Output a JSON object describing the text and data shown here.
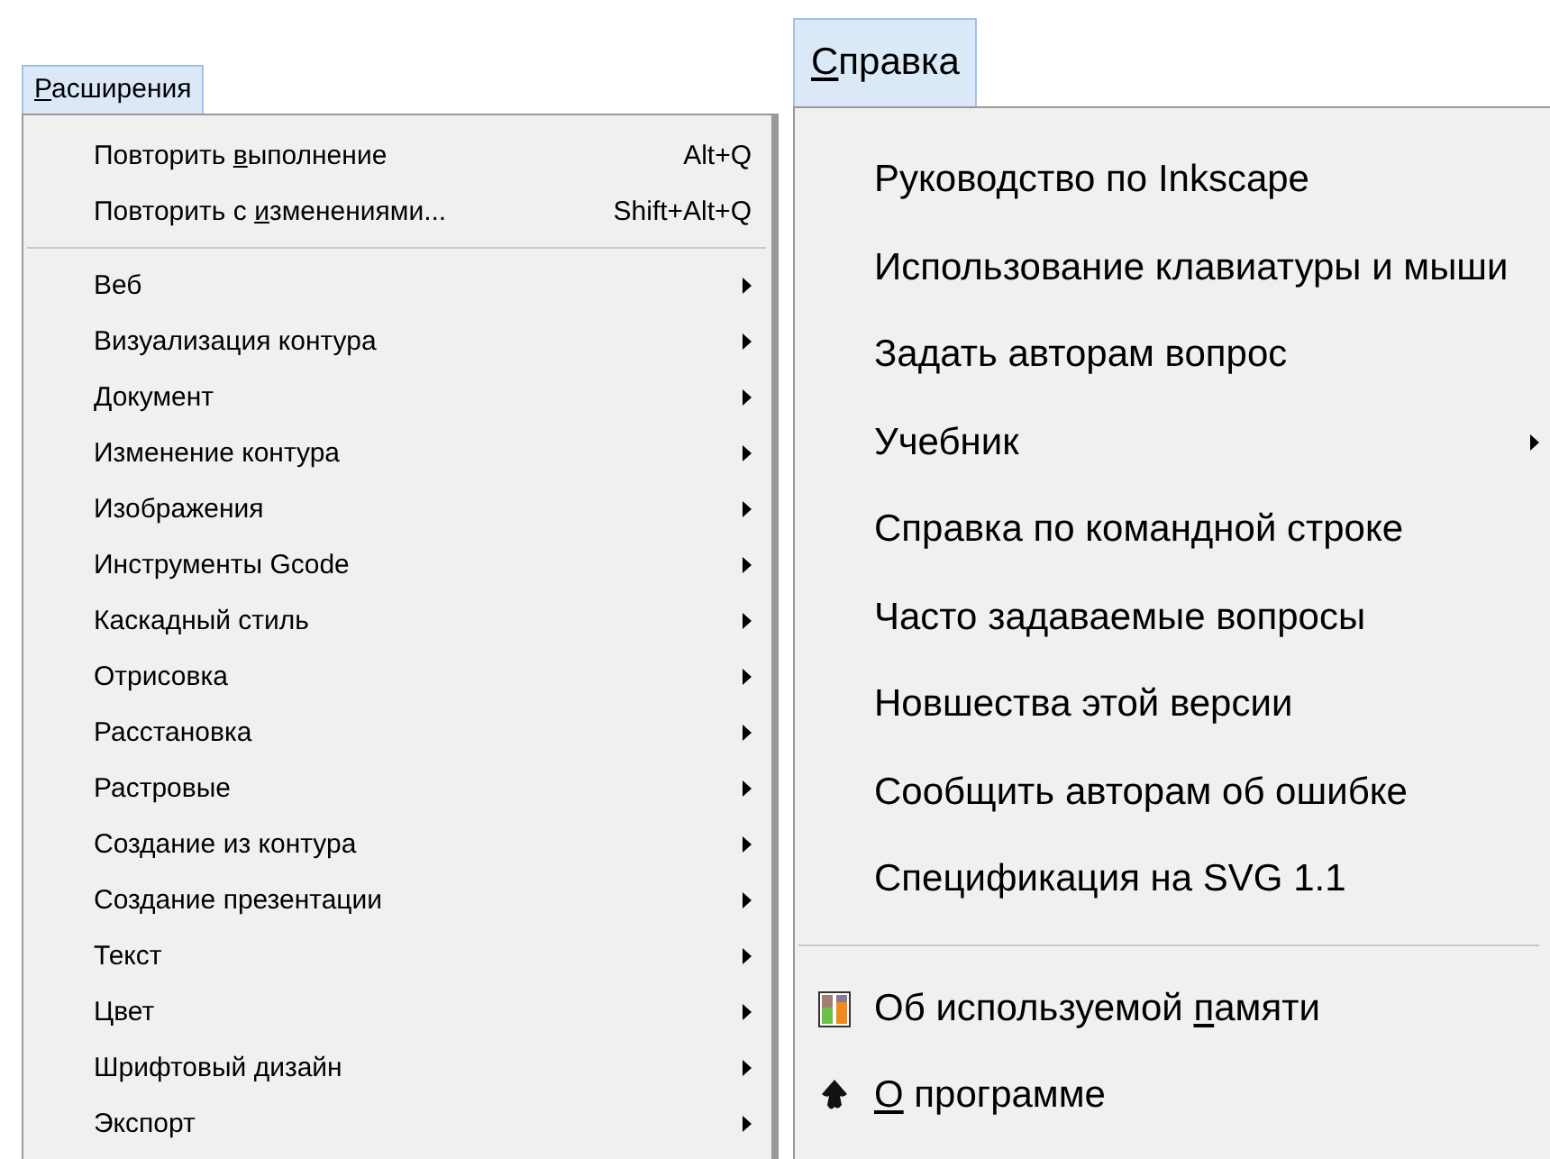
{
  "menus": [
    {
      "title": {
        "key": "Р",
        "after": "асширения"
      },
      "items": [
        {
          "kind": "command",
          "label_before": "Повторить ",
          "access_key": "в",
          "label_after": "ыполнение",
          "shortcut": "Alt+Q"
        },
        {
          "kind": "command",
          "label_before": "Повторить с ",
          "access_key": "и",
          "label_after": "зменениями...",
          "shortcut": "Shift+Alt+Q"
        },
        {
          "kind": "separator"
        },
        {
          "kind": "submenu",
          "label": "Веб"
        },
        {
          "kind": "submenu",
          "label": "Визуализация контура"
        },
        {
          "kind": "submenu",
          "label": "Документ"
        },
        {
          "kind": "submenu",
          "label": "Изменение контура"
        },
        {
          "kind": "submenu",
          "label": "Изображения"
        },
        {
          "kind": "submenu",
          "label": "Инструменты Gcode"
        },
        {
          "kind": "submenu",
          "label": "Каскадный стиль"
        },
        {
          "kind": "submenu",
          "label": "Отрисовка"
        },
        {
          "kind": "submenu",
          "label": "Расстановка"
        },
        {
          "kind": "submenu",
          "label": "Растровые"
        },
        {
          "kind": "submenu",
          "label": "Создание из контура"
        },
        {
          "kind": "submenu",
          "label": "Создание презентации"
        },
        {
          "kind": "submenu",
          "label": "Текст"
        },
        {
          "kind": "submenu",
          "label": "Цвет"
        },
        {
          "kind": "submenu",
          "label": "Шрифтовый дизайн"
        },
        {
          "kind": "submenu",
          "label": "Экспорт"
        }
      ]
    },
    {
      "title": {
        "key": "С",
        "after": "правка"
      },
      "items": [
        {
          "kind": "command",
          "label": "Руководство по Inkscape"
        },
        {
          "kind": "command",
          "label": "Использование клавиатуры и мыши"
        },
        {
          "kind": "command",
          "label": "Задать авторам вопрос"
        },
        {
          "kind": "submenu",
          "label": "Учебник"
        },
        {
          "kind": "command",
          "label": "Справка по командной строке"
        },
        {
          "kind": "command",
          "label": "Часто задаваемые вопросы"
        },
        {
          "kind": "command",
          "label": "Новшества этой версии"
        },
        {
          "kind": "command",
          "label": "Сообщить авторам об ошибке"
        },
        {
          "kind": "command",
          "label": "Спецификация на SVG 1.1"
        },
        {
          "kind": "separator"
        },
        {
          "kind": "memory",
          "label_before": "Об используемой ",
          "access_key": "п",
          "label_after": "амяти"
        },
        {
          "kind": "about",
          "access_key": "О",
          "label_after": " программе"
        }
      ]
    }
  ]
}
